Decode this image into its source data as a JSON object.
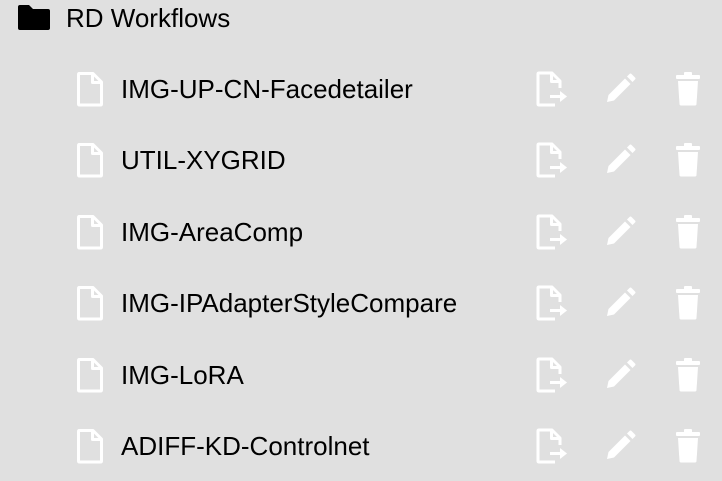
{
  "folder": {
    "name": "RD Workflows",
    "icon": "folder-icon"
  },
  "files": [
    {
      "name": "IMG-UP-CN-Facedetailer"
    },
    {
      "name": "UTIL-XYGRID"
    },
    {
      "name": "IMG-AreaComp"
    },
    {
      "name": "IMG-IPAdapterStyleCompare"
    },
    {
      "name": "IMG-LoRA"
    },
    {
      "name": "ADIFF-KD-Controlnet"
    }
  ],
  "icons": {
    "file": "file-icon",
    "export": "file-export-icon",
    "rename": "pencil-icon",
    "delete": "trash-icon"
  },
  "colors": {
    "background": "#e0e0e0",
    "icon": "#ffffff",
    "text": "#000000"
  }
}
